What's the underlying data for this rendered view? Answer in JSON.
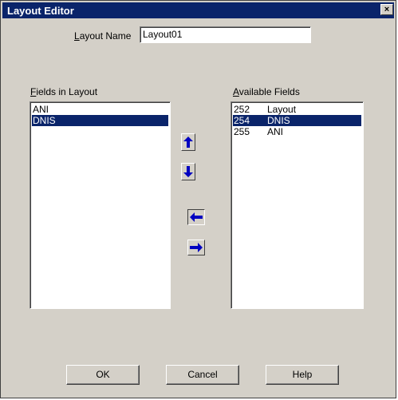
{
  "window": {
    "title": "Layout Editor",
    "close_glyph": "×"
  },
  "layout_name": {
    "label_prefix": "L",
    "label_rest": "ayout Name",
    "value": "Layout01"
  },
  "fields_in_layout": {
    "label_prefix": "F",
    "label_rest": "ields in Layout",
    "items": [
      "ANI",
      "DNIS"
    ],
    "selected_index": 1
  },
  "available_fields": {
    "label_prefix": "A",
    "label_rest": "vailable Fields",
    "items": [
      {
        "id": "252",
        "name": "Layout"
      },
      {
        "id": "254",
        "name": "DNIS"
      },
      {
        "id": "255",
        "name": "ANI"
      }
    ],
    "selected_index": 1
  },
  "icons": {
    "move_up": "up-arrow-icon",
    "move_down": "down-arrow-icon",
    "add": "left-arrow-icon",
    "remove": "right-arrow-icon"
  },
  "buttons": {
    "ok": "OK",
    "cancel": "Cancel",
    "help": "Help"
  },
  "colors": {
    "selection": "#0a246a",
    "arrow": "#0000c0",
    "face": "#d4d0c8"
  }
}
